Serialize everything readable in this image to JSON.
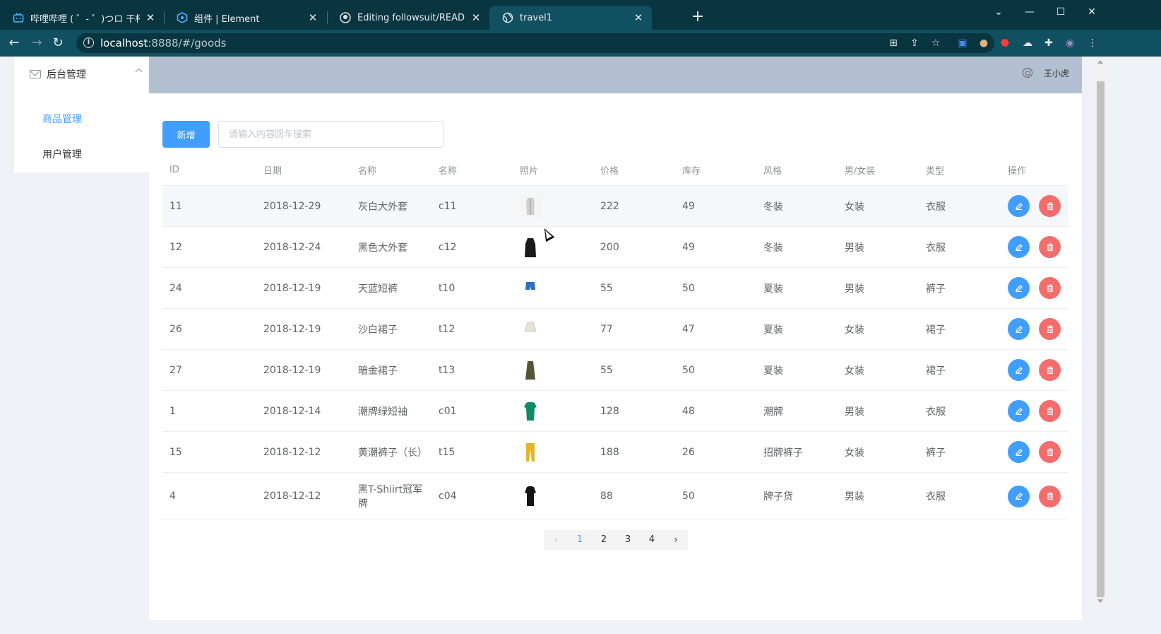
{
  "browser": {
    "tabs": [
      {
        "label": "哔哩哔哩 ( ゜- ゜)つロ 干杯~-bili",
        "icon": "bilibili-icon",
        "active": false
      },
      {
        "label": "组件 | Element",
        "icon": "element-icon",
        "active": false
      },
      {
        "label": "Editing followsuit/README.mc",
        "icon": "github-icon",
        "active": false
      },
      {
        "label": "travel1",
        "icon": "globe-icon",
        "active": true
      }
    ],
    "url_host": "localhost",
    "url_path": ":8888/#/goods"
  },
  "sidebar": {
    "group_label": "后台管理",
    "items": [
      {
        "label": "商品管理",
        "active": true
      },
      {
        "label": "用户管理",
        "active": false
      }
    ]
  },
  "header": {
    "username": "王小虎"
  },
  "toolbar": {
    "add_label": "新增",
    "search_placeholder": "请输入内容回车搜索"
  },
  "table": {
    "columns": [
      "ID",
      "日期",
      "名称",
      "名称",
      "照片",
      "价格",
      "库存",
      "风格",
      "男/女装",
      "类型",
      "操作"
    ],
    "rows": [
      {
        "id": "11",
        "date": "2018-12-29",
        "name": "灰白大外套",
        "code": "c11",
        "photo": "grey-coat",
        "price": "222",
        "stock": "49",
        "style": "冬装",
        "gender": "女装",
        "type": "衣服"
      },
      {
        "id": "12",
        "date": "2018-12-24",
        "name": "黑色大外套",
        "code": "c12",
        "photo": "black-coat",
        "price": "200",
        "stock": "49",
        "style": "冬装",
        "gender": "男装",
        "type": "衣服"
      },
      {
        "id": "24",
        "date": "2018-12-19",
        "name": "天蓝短裤",
        "code": "t10",
        "photo": "blue-shorts",
        "price": "55",
        "stock": "50",
        "style": "夏装",
        "gender": "男装",
        "type": "裤子"
      },
      {
        "id": "26",
        "date": "2018-12-19",
        "name": "沙白裙子",
        "code": "t12",
        "photo": "white-skirt",
        "price": "77",
        "stock": "47",
        "style": "夏装",
        "gender": "女装",
        "type": "裙子"
      },
      {
        "id": "27",
        "date": "2018-12-19",
        "name": "暗金裙子",
        "code": "t13",
        "photo": "olive-skirt",
        "price": "55",
        "stock": "50",
        "style": "夏装",
        "gender": "女装",
        "type": "裙子"
      },
      {
        "id": "1",
        "date": "2018-12-14",
        "name": "潮牌绿短袖",
        "code": "c01",
        "photo": "green-tshirt",
        "price": "128",
        "stock": "48",
        "style": "潮牌",
        "gender": "男装",
        "type": "衣服"
      },
      {
        "id": "15",
        "date": "2018-12-12",
        "name": "黄潮裤子（长）",
        "code": "t15",
        "photo": "yellow-pants",
        "price": "188",
        "stock": "26",
        "style": "招牌裤子",
        "gender": "女装",
        "type": "裤子"
      },
      {
        "id": "4",
        "date": "2018-12-12",
        "name": "黑T-Shiirt冠军牌",
        "code": "c04",
        "photo": "black-tshirt",
        "price": "88",
        "stock": "50",
        "style": "牌子货",
        "gender": "男装",
        "type": "衣服"
      }
    ]
  },
  "pagination": {
    "pages": [
      "1",
      "2",
      "3",
      "4"
    ],
    "current": "1"
  },
  "colors": {
    "primary": "#409eff",
    "danger": "#f56c6c",
    "header_bg": "#b3c0d1",
    "browser_bg": "#093541"
  }
}
